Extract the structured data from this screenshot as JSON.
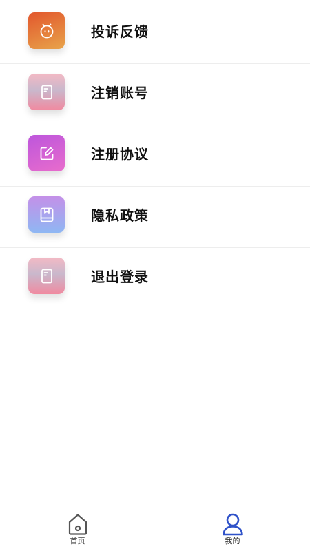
{
  "menu": {
    "items": [
      {
        "label": "投诉反馈",
        "icon": "robot-face-icon",
        "gradient": [
          "#e2572d",
          "#e8a34a"
        ]
      },
      {
        "label": "注销账号",
        "icon": "document-icon",
        "gradient": [
          "#f2b0bd",
          "#f28a9e"
        ]
      },
      {
        "label": "注册协议",
        "icon": "edit-icon",
        "gradient": [
          "#c75de0",
          "#e56ed0"
        ]
      },
      {
        "label": "隐私政策",
        "icon": "bookmark-book-icon",
        "gradient": [
          "#bf8ee8",
          "#8eb6f2"
        ]
      },
      {
        "label": "退出登录",
        "icon": "document-icon",
        "gradient": [
          "#f2b0bd",
          "#f28a9e"
        ]
      }
    ]
  },
  "tabbar": {
    "tabs": [
      {
        "label": "首页",
        "icon": "home-icon",
        "active": false
      },
      {
        "label": "我的",
        "icon": "user-icon",
        "active": true
      }
    ],
    "active_color": "#2f52c9",
    "inactive_color": "#555555"
  }
}
